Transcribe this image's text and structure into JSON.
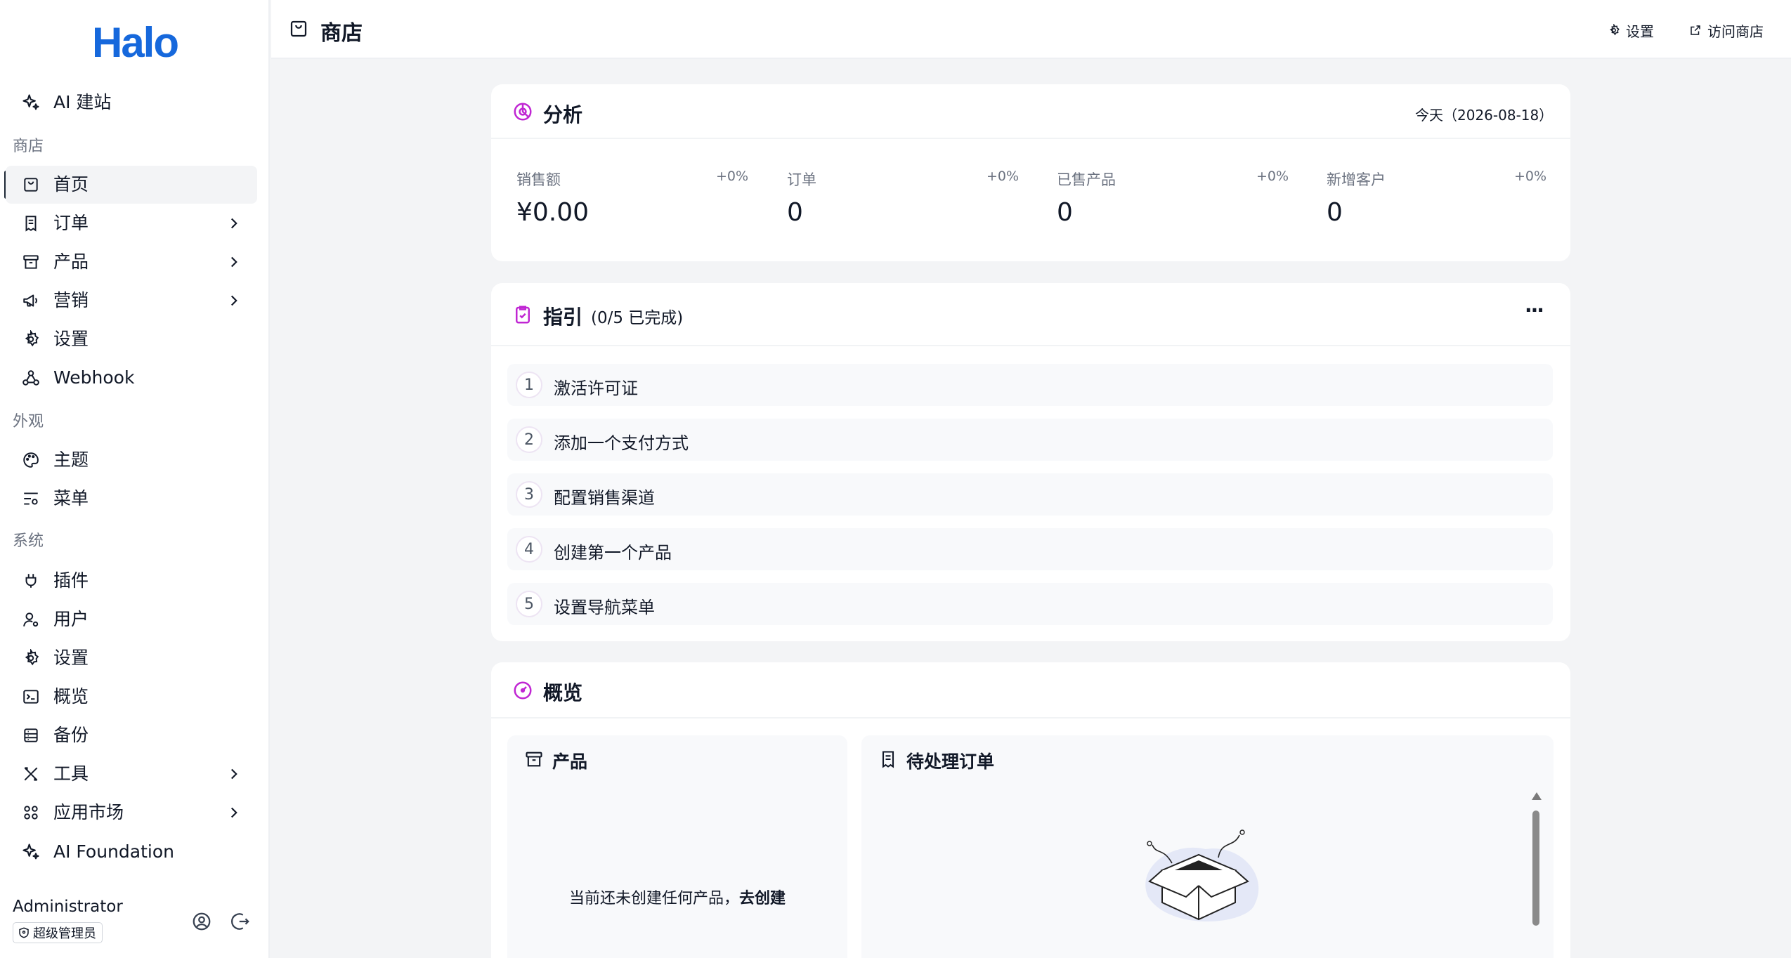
{
  "brand": {
    "logo_text": "Halo",
    "color": "#1668dc"
  },
  "sidebar": {
    "top_item": {
      "label": "AI 建站",
      "icon": "sparkle-icon"
    },
    "groups": [
      {
        "title": "商店"
      },
      {
        "title": "外观"
      },
      {
        "title": "系统"
      }
    ],
    "shop_items": [
      {
        "label": "首页",
        "icon": "bag-icon",
        "active": true
      },
      {
        "label": "订单",
        "icon": "receipt-icon",
        "has_submenu": true
      },
      {
        "label": "产品",
        "icon": "archive-icon",
        "has_submenu": true
      },
      {
        "label": "营销",
        "icon": "megaphone-icon",
        "has_submenu": true
      },
      {
        "label": "设置",
        "icon": "gear-icon"
      },
      {
        "label": "Webhook",
        "icon": "webhook-icon"
      }
    ],
    "appearance_items": [
      {
        "label": "主题",
        "icon": "palette-icon"
      },
      {
        "label": "菜单",
        "icon": "menu-settings-icon"
      }
    ],
    "system_items": [
      {
        "label": "插件",
        "icon": "plug-icon"
      },
      {
        "label": "用户",
        "icon": "user-settings-icon"
      },
      {
        "label": "设置",
        "icon": "gear-icon"
      },
      {
        "label": "概览",
        "icon": "terminal-icon"
      },
      {
        "label": "备份",
        "icon": "database-icon"
      },
      {
        "label": "工具",
        "icon": "tools-icon",
        "has_submenu": true
      },
      {
        "label": "应用市场",
        "icon": "apps-icon",
        "has_submenu": true
      },
      {
        "label": "AI Foundation",
        "icon": "sparkle-icon"
      }
    ],
    "user": {
      "name": "Administrator",
      "role": "超级管理员"
    }
  },
  "header": {
    "title": "商店",
    "settings_label": "设置",
    "visit_label": "访问商店"
  },
  "analytics": {
    "title": "分析",
    "date_label": "今天（2026-08-18）",
    "stats": [
      {
        "label": "销售额",
        "delta": "+0%",
        "value": "¥0.00"
      },
      {
        "label": "订单",
        "delta": "+0%",
        "value": "0"
      },
      {
        "label": "已售产品",
        "delta": "+0%",
        "value": "0"
      },
      {
        "label": "新增客户",
        "delta": "+0%",
        "value": "0"
      }
    ]
  },
  "guide": {
    "title": "指引",
    "progress": "(0/5 已完成)",
    "more_label": "···",
    "steps": [
      {
        "num": "1",
        "label": "激活许可证"
      },
      {
        "num": "2",
        "label": "添加一个支付方式"
      },
      {
        "num": "3",
        "label": "配置销售渠道"
      },
      {
        "num": "4",
        "label": "创建第一个产品"
      },
      {
        "num": "5",
        "label": "设置导航菜单"
      }
    ]
  },
  "overview": {
    "title": "概览",
    "products_title": "产品",
    "products_empty": "当前还未创建任何产品，",
    "products_create_link": "去创建",
    "orders_title": "待处理订单"
  },
  "colors": {
    "accent": "#c026d3",
    "text": "#111827",
    "muted": "#6b7280",
    "bg": "#f3f4f6"
  }
}
